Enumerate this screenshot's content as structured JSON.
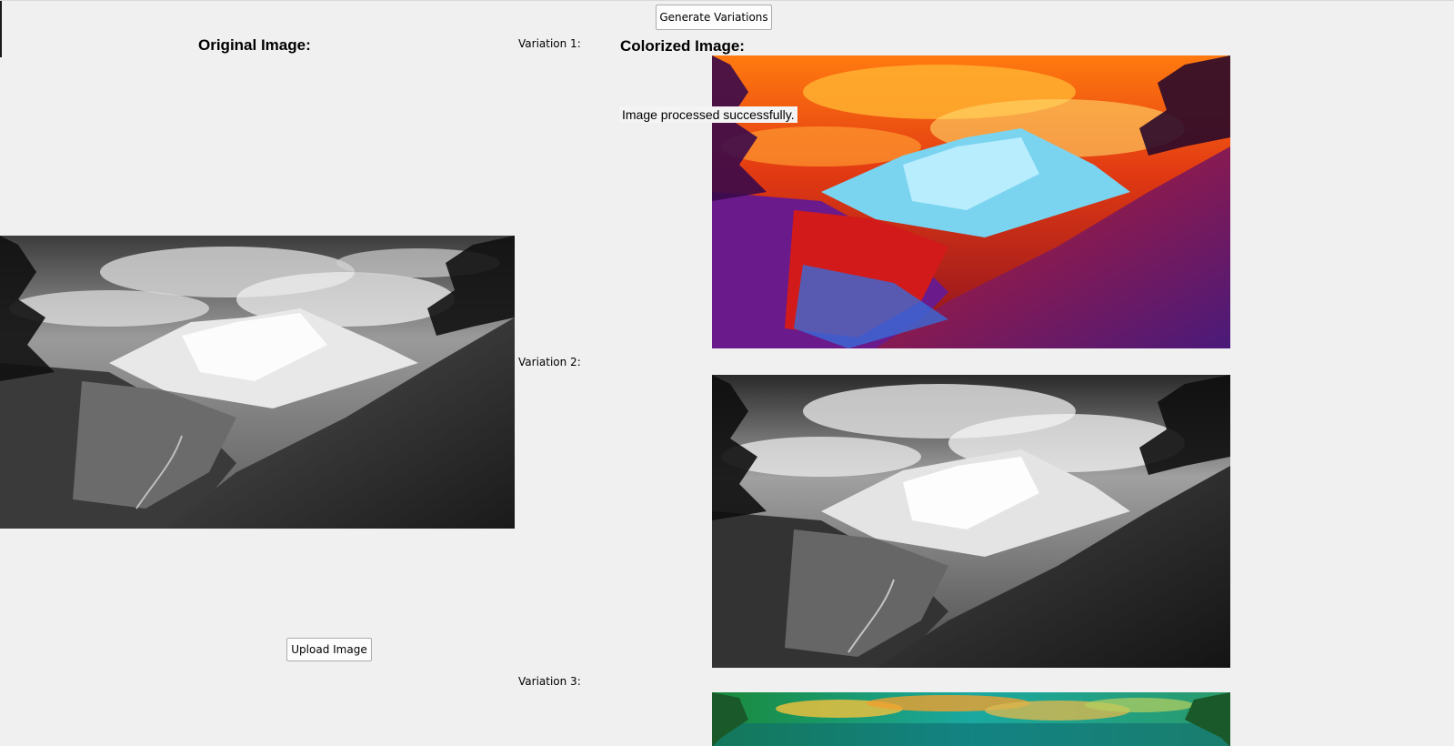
{
  "window": {
    "generate_button": "Generate Variations",
    "upload_button": "Upload Image",
    "original_heading": "Original Image:",
    "colorized_heading": "Colorized Image:",
    "status_text": "Image processed successfully.",
    "variations": [
      {
        "label": "Variation 1:",
        "style": "warm-psychedelic"
      },
      {
        "label": "Variation 2:",
        "style": "grayscale"
      },
      {
        "label": "Variation 3:",
        "style": "green-teal"
      }
    ]
  },
  "images": {
    "original": {
      "subject": "mountain-landscape",
      "tone": "grayscale"
    }
  },
  "colors": {
    "background": "#f0f0f0",
    "button_face": "#fdfdfd",
    "button_border": "#adadad"
  }
}
